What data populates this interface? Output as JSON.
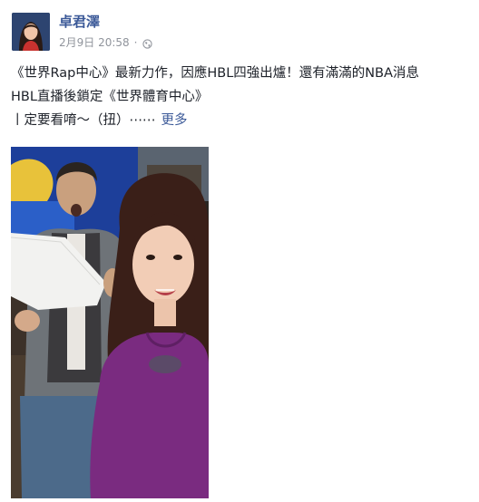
{
  "post": {
    "author": "卓君澤",
    "timestamp": "2月9日 20:58",
    "separator": "·",
    "privacy_icon": "globe-icon",
    "text_lines": [
      "《世界Rap中心》最新力作，因應HBL四強出爐！還有滿滿的NBA消息",
      "HBL直播後鎖定《世界體育中心》",
      "丨定要看唷～（扭）⋯⋯"
    ],
    "more_label": "更多"
  },
  "colors": {
    "author_link": "#3b5998",
    "meta_text": "#90949c",
    "body_text": "#1d2129",
    "sweater": "#7a2b80"
  }
}
